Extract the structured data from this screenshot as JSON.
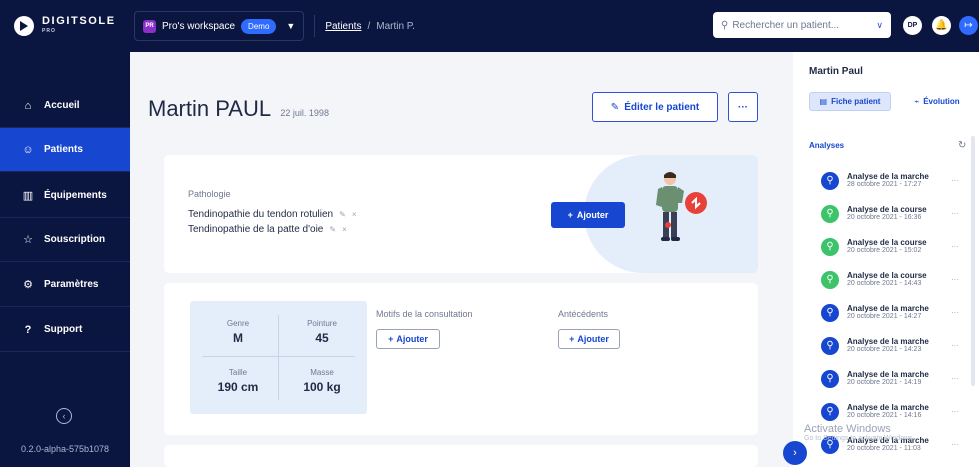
{
  "topbar": {
    "logo_text": "DIGITSOLE",
    "logo_sub": "PRO",
    "workspace_badge": "PR",
    "workspace_name": "Pro's workspace",
    "workspace_tag": "Demo",
    "crumb_root": "Patients",
    "crumb_sep": "/",
    "crumb_current": "Martin P.",
    "search_placeholder": "Rechercher un patient...",
    "avatar_initials": "DP"
  },
  "sidebar": {
    "items": [
      {
        "label": "Accueil",
        "icon": "home-icon",
        "glyph": "⌂"
      },
      {
        "label": "Patients",
        "icon": "patients-icon",
        "glyph": "☺"
      },
      {
        "label": "Équipements",
        "icon": "equipment-icon",
        "glyph": "▥"
      },
      {
        "label": "Souscription",
        "icon": "subscription-icon",
        "glyph": "☆"
      },
      {
        "label": "Paramètres",
        "icon": "settings-icon",
        "glyph": "⚙"
      },
      {
        "label": "Support",
        "icon": "support-icon",
        "glyph": "?"
      }
    ],
    "version": "0.2.0-alpha-575b1078"
  },
  "patient": {
    "first_name": "Martin",
    "last_name": "PAUL",
    "birth_date": "22 juil. 1998",
    "edit_label": "Éditer le patient",
    "more_label": "···"
  },
  "pathology": {
    "title": "Pathologie",
    "items": [
      "Tendinopathie du tendon rotulien",
      "Tendinopathie de la patte d'oie"
    ],
    "add_label": "Ajouter"
  },
  "profile": {
    "genre_label": "Genre",
    "genre_value": "M",
    "pointure_label": "Pointure",
    "pointure_value": "45",
    "taille_label": "Taille",
    "taille_value": "190 cm",
    "masse_label": "Masse",
    "masse_value": "100 kg",
    "motifs_title": "Motifs de la consultation",
    "antecedents_title": "Antécédents",
    "add_label": "Ajouter"
  },
  "right_panel": {
    "name": "Martin Paul",
    "tab_fiche": "Fiche patient",
    "tab_evolution": "Évolution",
    "analyses_title": "Analyses",
    "analyses": [
      {
        "title": "Analyse de la marche",
        "date": "28 octobre 2021 - 17:27",
        "kind": "walk"
      },
      {
        "title": "Analyse de la course",
        "date": "20 octobre 2021 - 16:36",
        "kind": "run"
      },
      {
        "title": "Analyse de la course",
        "date": "20 octobre 2021 - 15:02",
        "kind": "run"
      },
      {
        "title": "Analyse de la course",
        "date": "20 octobre 2021 - 14:43",
        "kind": "run"
      },
      {
        "title": "Analyse de la marche",
        "date": "20 octobre 2021 - 14:27",
        "kind": "walk"
      },
      {
        "title": "Analyse de la marche",
        "date": "20 octobre 2021 - 14:23",
        "kind": "walk"
      },
      {
        "title": "Analyse de la marche",
        "date": "20 octobre 2021 - 14:19",
        "kind": "walk"
      },
      {
        "title": "Analyse de la marche",
        "date": "20 octobre 2021 - 14:16",
        "kind": "walk"
      },
      {
        "title": "Analyse de la marche",
        "date": "20 octobre 2021 - 11:03",
        "kind": "walk"
      }
    ]
  },
  "watermark": {
    "line1": "Activate Windows",
    "line2": "Go to Settings to activate Windows."
  },
  "colors": {
    "navy": "#0b1640",
    "primary": "#1746d1",
    "walk": "#1746d1",
    "run": "#3dc46a",
    "light_blue": "#e4eefa"
  }
}
